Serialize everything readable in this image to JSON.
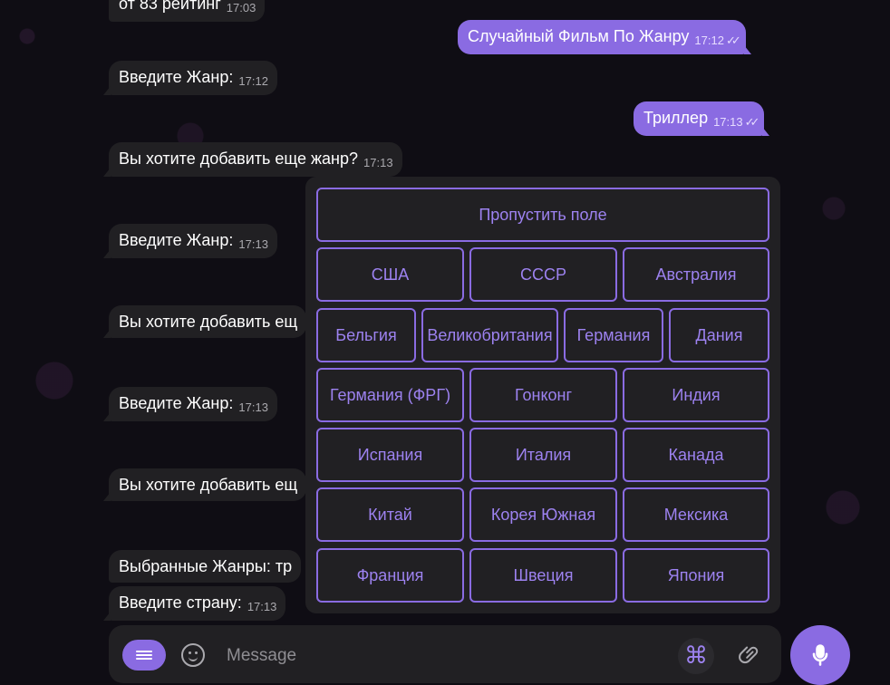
{
  "chat": {
    "messages": [
      {
        "text": "от 83 рейтинг",
        "time": "17:03",
        "dir": "in"
      },
      {
        "text": "Случайный Фильм По Жанру",
        "time": "17:12",
        "dir": "out"
      },
      {
        "text": "Введите Жанр:",
        "time": "17:12",
        "dir": "in"
      },
      {
        "text": "Триллер",
        "time": "17:13",
        "dir": "out"
      },
      {
        "text": "Вы хотите добавить еще жанр?",
        "time": "17:13",
        "dir": "in"
      },
      {
        "text": "Введите Жанр:",
        "time": "17:13",
        "dir": "in"
      },
      {
        "text": "Вы хотите добавить ещ",
        "time": "",
        "dir": "in"
      },
      {
        "text": "Введите Жанр:",
        "time": "17:13",
        "dir": "in"
      },
      {
        "text": "Вы хотите добавить ещ",
        "time": "",
        "dir": "in"
      },
      {
        "text": "Выбранные Жанры: тр",
        "time": "",
        "dir": "in"
      },
      {
        "text": "Введите страну:",
        "time": "17:13",
        "dir": "in"
      }
    ],
    "read_checks": "✓✓"
  },
  "keyboard": {
    "skip": "Пропустить поле",
    "rows": [
      [
        "США",
        "СССР",
        "Австралия"
      ],
      [
        "Бельгия",
        "Великобритания",
        "Германия",
        "Дания"
      ],
      [
        "Германия (ФРГ)",
        "Гонконг",
        "Индия"
      ],
      [
        "Испания",
        "Италия",
        "Канада"
      ],
      [
        "Китай",
        "Корея Южная",
        "Мексика"
      ],
      [
        "Франция",
        "Швеция",
        "Япония"
      ]
    ]
  },
  "composer": {
    "placeholder": "Message",
    "menu_icon": "menu-icon",
    "emoji_icon": "smile-icon",
    "commands_icon": "command-icon",
    "commands_glyph": "⌘",
    "attach_icon": "paperclip-icon",
    "attach_glyph": "📎",
    "send_icon": "microphone-icon"
  },
  "colors": {
    "accent": "#8a6be2",
    "bubble_in": "#212023",
    "background": "#0f0d14",
    "button_text": "#9d82f0"
  }
}
